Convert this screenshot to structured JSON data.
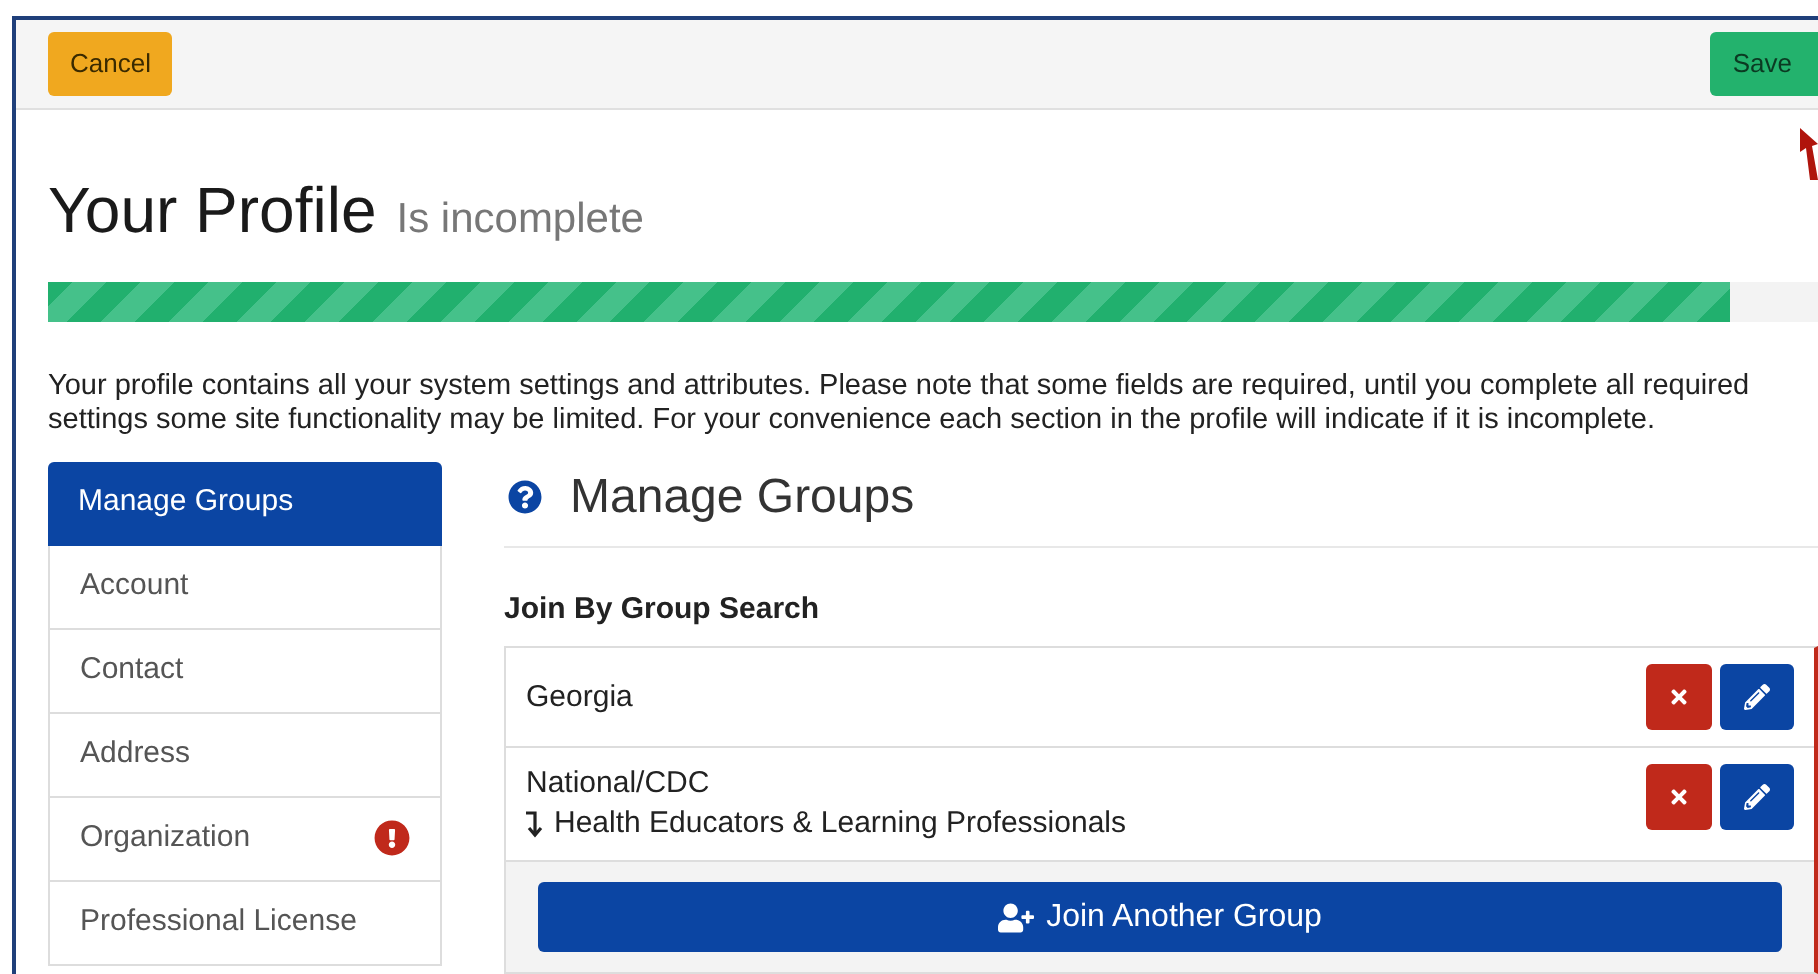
{
  "toolbar": {
    "cancel": "Cancel",
    "save": "Save"
  },
  "header": {
    "title": "Your Profile",
    "status": "Is incomplete"
  },
  "progress": {
    "level": 0.95
  },
  "intro": "Your profile contains all your system settings and attributes. Please note that some fields are required, until you complete all required settings some site functionality may be limited. For your convenience each section in the profile will indicate if it is incomplete.",
  "sidebar": {
    "items": [
      {
        "label": "Manage Groups",
        "selected": true,
        "incomplete": false
      },
      {
        "label": "Account",
        "selected": false,
        "incomplete": false
      },
      {
        "label": "Contact",
        "selected": false,
        "incomplete": false
      },
      {
        "label": "Address",
        "selected": false,
        "incomplete": false
      },
      {
        "label": "Organization",
        "selected": false,
        "incomplete": true
      },
      {
        "label": "Professional License",
        "selected": false,
        "incomplete": false
      }
    ]
  },
  "section": {
    "title": "Manage Groups",
    "subtitle": "Join By Group Search",
    "groups": [
      {
        "name": "Georgia"
      },
      {
        "name": "National/CDC",
        "subgroup": "Health Educators & Learning Professionals"
      }
    ],
    "join_button": "Join Another Group"
  }
}
